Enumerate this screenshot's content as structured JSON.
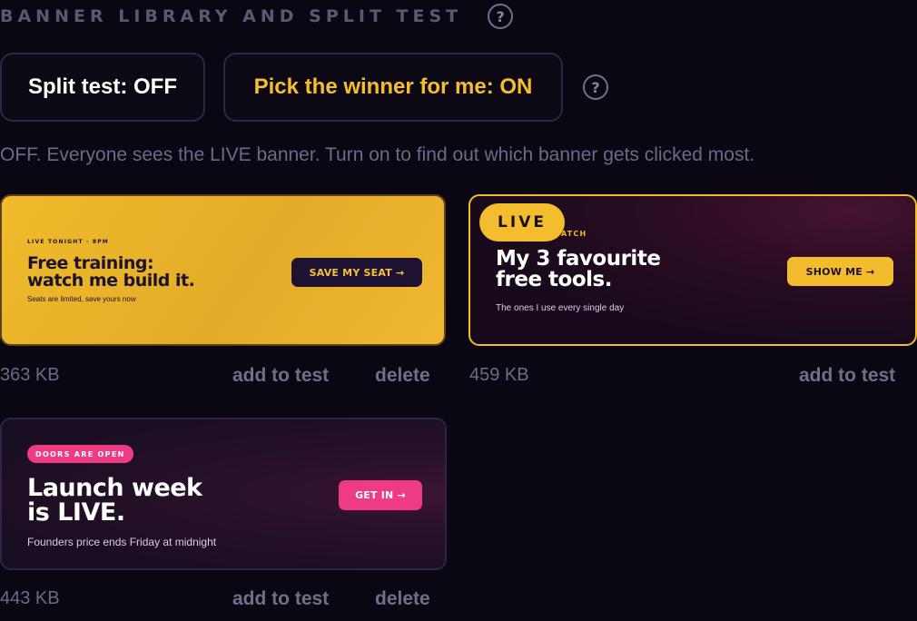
{
  "header": {
    "title": "BANNER LIBRARY AND SPLIT TEST",
    "help_glyph": "?"
  },
  "toggles": {
    "split_test_label": "Split test: OFF",
    "pick_winner_label": "Pick the winner for me: ON",
    "help_glyph": "?"
  },
  "description": "OFF. Everyone sees the LIVE banner. Turn on to find out which banner gets clicked most.",
  "banners": [
    {
      "eyebrow": "LIVE TONIGHT · 8PM",
      "headline_line1": "Free training:",
      "headline_line2": "watch me build it.",
      "subtext": "Seats are limited, save yours now",
      "cta": "SAVE MY SEAT →",
      "size": "363 KB",
      "add_label": "add to test",
      "delete_label": "delete",
      "live": false,
      "bg_color": "#f1bb2c"
    },
    {
      "eyebrow": "ATCH",
      "headline_line1": "My 3 favourite",
      "headline_line2": "free tools.",
      "subtext": "The ones I use every single day",
      "cta": "SHOW ME →",
      "size": "459 KB",
      "add_label": "add to test",
      "live": true,
      "live_label": "LIVE",
      "accent_color": "#f2bc2d"
    },
    {
      "eyebrow": "DOORS ARE OPEN",
      "headline_line1": "Launch week",
      "headline_line2": "is LIVE.",
      "subtext": "Founders price ends Friday at midnight",
      "cta": "GET IN →",
      "size": "443 KB",
      "add_label": "add to test",
      "delete_label": "delete",
      "live": false,
      "accent_color": "#ee3b84"
    }
  ],
  "colors": {
    "background": "#0b0712",
    "accent_yellow": "#f6be2d",
    "accent_pink": "#ee3b84",
    "muted_text": "#6f6888"
  }
}
